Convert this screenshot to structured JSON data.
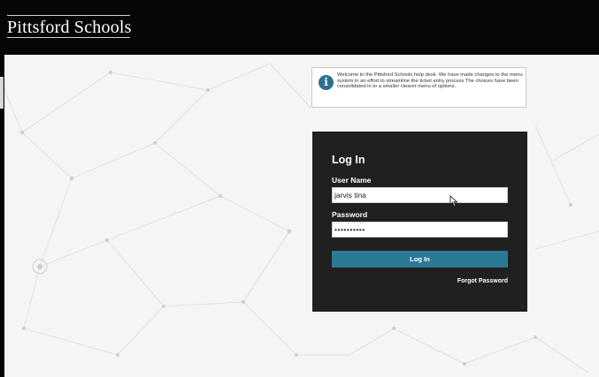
{
  "header": {
    "brand": "Pittsford Schools",
    "background": "#060606"
  },
  "notice": {
    "icon": "info-icon",
    "icon_glyph": "i",
    "text": "Welcome to the Pittsford Schools help desk. We have made changes to the menu system in an effort to streamline the ticket entry process The choices have been consolidated in to a smaller clearer menu of options."
  },
  "login": {
    "title": "Log In",
    "username_label": "User Name",
    "username_value": "jarvis tina",
    "password_label": "Password",
    "password_value": "••••••••••",
    "button_label": "Log In",
    "forgot_label": "Forgot Password"
  },
  "colors": {
    "accent": "#2a7a96",
    "panel": "#202020",
    "background": "#f5f5f5"
  }
}
